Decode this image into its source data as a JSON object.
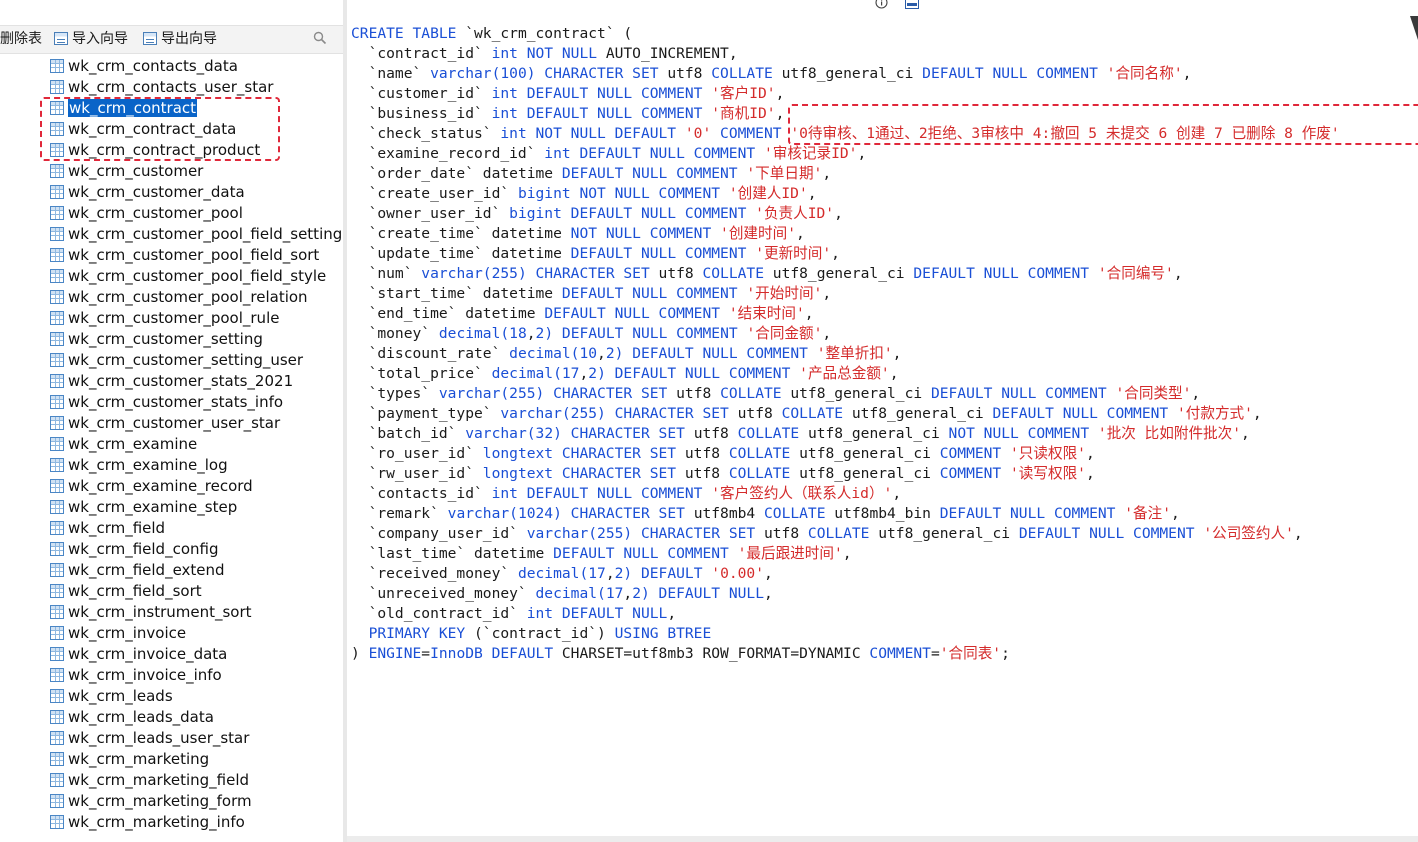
{
  "toolbar": {
    "delete_label": "删除表",
    "import_label": "导入向导",
    "export_label": "导出向导"
  },
  "tree_items": [
    "wk_crm_contacts_data",
    "wk_crm_contacts_user_star",
    "wk_crm_contract",
    "wk_crm_contract_data",
    "wk_crm_contract_product",
    "wk_crm_customer",
    "wk_crm_customer_data",
    "wk_crm_customer_pool",
    "wk_crm_customer_pool_field_setting",
    "wk_crm_customer_pool_field_sort",
    "wk_crm_customer_pool_field_style",
    "wk_crm_customer_pool_relation",
    "wk_crm_customer_pool_rule",
    "wk_crm_customer_setting",
    "wk_crm_customer_setting_user",
    "wk_crm_customer_stats_2021",
    "wk_crm_customer_stats_info",
    "wk_crm_customer_user_star",
    "wk_crm_examine",
    "wk_crm_examine_log",
    "wk_crm_examine_record",
    "wk_crm_examine_step",
    "wk_crm_field",
    "wk_crm_field_config",
    "wk_crm_field_extend",
    "wk_crm_field_sort",
    "wk_crm_instrument_sort",
    "wk_crm_invoice",
    "wk_crm_invoice_data",
    "wk_crm_invoice_info",
    "wk_crm_leads",
    "wk_crm_leads_data",
    "wk_crm_leads_user_star",
    "wk_crm_marketing",
    "wk_crm_marketing_field",
    "wk_crm_marketing_form",
    "wk_crm_marketing_info"
  ],
  "selected_index": 2,
  "icons": {
    "toolbar_import": "table-import-icon",
    "toolbar_export": "table-export-icon",
    "search": "search-icon",
    "info": "info-icon",
    "ddl": "ddl-icon",
    "table": "table-icon"
  },
  "colors": {
    "keyword": "#1a4fd6",
    "string": "#d42b2b",
    "selection": "#0a64c8",
    "annotation": "#e0283a"
  },
  "ddl_lines": [
    [
      [
        "k",
        "CREATE TABLE "
      ],
      [
        "t",
        "`wk_crm_contract` ("
      ]
    ],
    [
      [
        "t",
        "  `contract_id` "
      ],
      [
        "k",
        "int NOT NULL "
      ],
      [
        "t",
        "AUTO_INCREMENT,"
      ]
    ],
    [
      [
        "t",
        "  `name` "
      ],
      [
        "k",
        "varchar("
      ],
      [
        "n",
        "100"
      ],
      [
        "k",
        ") CHARACTER SET "
      ],
      [
        "t",
        "utf8 "
      ],
      [
        "k",
        "COLLATE "
      ],
      [
        "t",
        "utf8_general_ci "
      ],
      [
        "k",
        "DEFAULT NULL COMMENT "
      ],
      [
        "s",
        "'合同名称'"
      ],
      [
        "t",
        ","
      ]
    ],
    [
      [
        "t",
        "  `customer_id` "
      ],
      [
        "k",
        "int DEFAULT NULL COMMENT "
      ],
      [
        "s",
        "'客户ID'"
      ],
      [
        "t",
        ","
      ]
    ],
    [
      [
        "t",
        "  `business_id` "
      ],
      [
        "k",
        "int DEFAULT NULL COMMENT "
      ],
      [
        "s",
        "'商机ID'"
      ],
      [
        "t",
        ","
      ]
    ],
    [
      [
        "t",
        "  `check_status` "
      ],
      [
        "k",
        "int NOT NULL DEFAULT "
      ],
      [
        "s",
        "'0'"
      ],
      [
        "k",
        " COMMENT "
      ],
      [
        "s",
        "'0待审核、1通过、2拒绝、3审核中 4:撤回 5 未提交 6 创建 7 已删除 8 作废'"
      ]
    ],
    [
      [
        "t",
        "  `examine_record_id` "
      ],
      [
        "k",
        "int DEFAULT NULL COMMENT "
      ],
      [
        "s",
        "'审核记录ID'"
      ],
      [
        "t",
        ","
      ]
    ],
    [
      [
        "t",
        "  `order_date` "
      ],
      [
        "t",
        "datetime "
      ],
      [
        "k",
        "DEFAULT NULL COMMENT "
      ],
      [
        "s",
        "'下单日期'"
      ],
      [
        "t",
        ","
      ]
    ],
    [
      [
        "t",
        "  `create_user_id` "
      ],
      [
        "k",
        "bigint NOT NULL COMMENT "
      ],
      [
        "s",
        "'创建人ID'"
      ],
      [
        "t",
        ","
      ]
    ],
    [
      [
        "t",
        "  `owner_user_id` "
      ],
      [
        "k",
        "bigint DEFAULT NULL COMMENT "
      ],
      [
        "s",
        "'负责人ID'"
      ],
      [
        "t",
        ","
      ]
    ],
    [
      [
        "t",
        "  `create_time` "
      ],
      [
        "t",
        "datetime "
      ],
      [
        "k",
        "NOT NULL COMMENT "
      ],
      [
        "s",
        "'创建时间'"
      ],
      [
        "t",
        ","
      ]
    ],
    [
      [
        "t",
        "  `update_time` "
      ],
      [
        "t",
        "datetime "
      ],
      [
        "k",
        "DEFAULT NULL COMMENT "
      ],
      [
        "s",
        "'更新时间'"
      ],
      [
        "t",
        ","
      ]
    ],
    [
      [
        "t",
        "  `num` "
      ],
      [
        "k",
        "varchar("
      ],
      [
        "n",
        "255"
      ],
      [
        "k",
        ") CHARACTER SET "
      ],
      [
        "t",
        "utf8 "
      ],
      [
        "k",
        "COLLATE "
      ],
      [
        "t",
        "utf8_general_ci "
      ],
      [
        "k",
        "DEFAULT NULL COMMENT "
      ],
      [
        "s",
        "'合同编号'"
      ],
      [
        "t",
        ","
      ]
    ],
    [
      [
        "t",
        "  `start_time` "
      ],
      [
        "t",
        "datetime "
      ],
      [
        "k",
        "DEFAULT NULL COMMENT "
      ],
      [
        "s",
        "'开始时间'"
      ],
      [
        "t",
        ","
      ]
    ],
    [
      [
        "t",
        "  `end_time` "
      ],
      [
        "t",
        "datetime "
      ],
      [
        "k",
        "DEFAULT NULL COMMENT "
      ],
      [
        "s",
        "'结束时间'"
      ],
      [
        "t",
        ","
      ]
    ],
    [
      [
        "t",
        "  `money` "
      ],
      [
        "k",
        "decimal("
      ],
      [
        "n",
        "18"
      ],
      [
        "t",
        ","
      ],
      [
        "n",
        "2"
      ],
      [
        "k",
        ") DEFAULT NULL COMMENT "
      ],
      [
        "s",
        "'合同金额'"
      ],
      [
        "t",
        ","
      ]
    ],
    [
      [
        "t",
        "  `discount_rate` "
      ],
      [
        "k",
        "decimal("
      ],
      [
        "n",
        "10"
      ],
      [
        "t",
        ","
      ],
      [
        "n",
        "2"
      ],
      [
        "k",
        ") DEFAULT NULL COMMENT "
      ],
      [
        "s",
        "'整单折扣'"
      ],
      [
        "t",
        ","
      ]
    ],
    [
      [
        "t",
        "  `total_price` "
      ],
      [
        "k",
        "decimal("
      ],
      [
        "n",
        "17"
      ],
      [
        "t",
        ","
      ],
      [
        "n",
        "2"
      ],
      [
        "k",
        ") DEFAULT NULL COMMENT "
      ],
      [
        "s",
        "'产品总金额'"
      ],
      [
        "t",
        ","
      ]
    ],
    [
      [
        "t",
        "  `types` "
      ],
      [
        "k",
        "varchar("
      ],
      [
        "n",
        "255"
      ],
      [
        "k",
        ") CHARACTER SET "
      ],
      [
        "t",
        "utf8 "
      ],
      [
        "k",
        "COLLATE "
      ],
      [
        "t",
        "utf8_general_ci "
      ],
      [
        "k",
        "DEFAULT NULL COMMENT "
      ],
      [
        "s",
        "'合同类型'"
      ],
      [
        "t",
        ","
      ]
    ],
    [
      [
        "t",
        "  `payment_type` "
      ],
      [
        "k",
        "varchar("
      ],
      [
        "n",
        "255"
      ],
      [
        "k",
        ") CHARACTER SET "
      ],
      [
        "t",
        "utf8 "
      ],
      [
        "k",
        "COLLATE "
      ],
      [
        "t",
        "utf8_general_ci "
      ],
      [
        "k",
        "DEFAULT NULL COMMENT "
      ],
      [
        "s",
        "'付款方式'"
      ],
      [
        "t",
        ","
      ]
    ],
    [
      [
        "t",
        "  `batch_id` "
      ],
      [
        "k",
        "varchar("
      ],
      [
        "n",
        "32"
      ],
      [
        "k",
        ") CHARACTER SET "
      ],
      [
        "t",
        "utf8 "
      ],
      [
        "k",
        "COLLATE "
      ],
      [
        "t",
        "utf8_general_ci "
      ],
      [
        "k",
        "NOT NULL COMMENT "
      ],
      [
        "s",
        "'批次 比如附件批次'"
      ],
      [
        "t",
        ","
      ]
    ],
    [
      [
        "t",
        "  `ro_user_id` "
      ],
      [
        "k",
        "longtext CHARACTER SET "
      ],
      [
        "t",
        "utf8 "
      ],
      [
        "k",
        "COLLATE "
      ],
      [
        "t",
        "utf8_general_ci "
      ],
      [
        "k",
        "COMMENT "
      ],
      [
        "s",
        "'只读权限'"
      ],
      [
        "t",
        ","
      ]
    ],
    [
      [
        "t",
        "  `rw_user_id` "
      ],
      [
        "k",
        "longtext CHARACTER SET "
      ],
      [
        "t",
        "utf8 "
      ],
      [
        "k",
        "COLLATE "
      ],
      [
        "t",
        "utf8_general_ci "
      ],
      [
        "k",
        "COMMENT "
      ],
      [
        "s",
        "'读写权限'"
      ],
      [
        "t",
        ","
      ]
    ],
    [
      [
        "t",
        "  `contacts_id` "
      ],
      [
        "k",
        "int DEFAULT NULL COMMENT "
      ],
      [
        "s",
        "'客户签约人（联系人id）'"
      ],
      [
        "t",
        ","
      ]
    ],
    [
      [
        "t",
        "  `remark` "
      ],
      [
        "k",
        "varchar("
      ],
      [
        "n",
        "1024"
      ],
      [
        "k",
        ") CHARACTER SET "
      ],
      [
        "t",
        "utf8mb4 "
      ],
      [
        "k",
        "COLLATE "
      ],
      [
        "t",
        "utf8mb4_bin "
      ],
      [
        "k",
        "DEFAULT NULL COMMENT "
      ],
      [
        "s",
        "'备注'"
      ],
      [
        "t",
        ","
      ]
    ],
    [
      [
        "t",
        "  `company_user_id` "
      ],
      [
        "k",
        "varchar("
      ],
      [
        "n",
        "255"
      ],
      [
        "k",
        ") CHARACTER SET "
      ],
      [
        "t",
        "utf8 "
      ],
      [
        "k",
        "COLLATE "
      ],
      [
        "t",
        "utf8_general_ci "
      ],
      [
        "k",
        "DEFAULT NULL COMMENT "
      ],
      [
        "s",
        "'公司签约人'"
      ],
      [
        "t",
        ","
      ]
    ],
    [
      [
        "t",
        "  `last_time` "
      ],
      [
        "t",
        "datetime "
      ],
      [
        "k",
        "DEFAULT NULL COMMENT "
      ],
      [
        "s",
        "'最后跟进时间'"
      ],
      [
        "t",
        ","
      ]
    ],
    [
      [
        "t",
        "  `received_money` "
      ],
      [
        "k",
        "decimal("
      ],
      [
        "n",
        "17"
      ],
      [
        "t",
        ","
      ],
      [
        "n",
        "2"
      ],
      [
        "k",
        ") DEFAULT "
      ],
      [
        "s",
        "'0.00'"
      ],
      [
        "t",
        ","
      ]
    ],
    [
      [
        "t",
        "  `unreceived_money` "
      ],
      [
        "k",
        "decimal("
      ],
      [
        "n",
        "17"
      ],
      [
        "t",
        ","
      ],
      [
        "n",
        "2"
      ],
      [
        "k",
        ") DEFAULT NULL"
      ],
      [
        "t",
        ","
      ]
    ],
    [
      [
        "t",
        "  `old_contract_id` "
      ],
      [
        "k",
        "int DEFAULT NULL"
      ],
      [
        "t",
        ","
      ]
    ],
    [
      [
        "k",
        "  PRIMARY KEY "
      ],
      [
        "t",
        "(`contract_id`) "
      ],
      [
        "k",
        "USING BTREE"
      ]
    ],
    [
      [
        "t",
        ") "
      ],
      [
        "k",
        "ENGINE"
      ],
      [
        "t",
        "="
      ],
      [
        "k",
        "InnoDB DEFAULT "
      ],
      [
        "t",
        "CHARSET=utf8mb3 ROW_FORMAT=DYNAMIC "
      ],
      [
        "k",
        "COMMENT"
      ],
      [
        "t",
        "="
      ],
      [
        "s",
        "'合同表'"
      ],
      [
        "t",
        ";"
      ]
    ]
  ]
}
